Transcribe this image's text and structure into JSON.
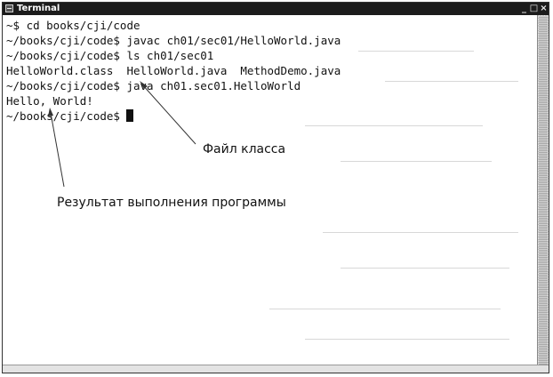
{
  "window": {
    "title": "Terminal",
    "controls": {
      "minimize": "_",
      "maximize": "□",
      "close": "×"
    }
  },
  "terminal": {
    "lines": [
      "~$ cd books/cji/code",
      "~/books/cji/code$ javac ch01/sec01/HelloWorld.java",
      "~/books/cji/code$ ls ch01/sec01",
      "HelloWorld.class  HelloWorld.java  MethodDemo.java",
      "~/books/cji/code$ java ch01.sec01.HelloWorld",
      "Hello, World!"
    ],
    "last_prompt": "~/books/cji/code$ "
  },
  "annotations": {
    "class_file": "Файл класса",
    "program_output": "Результат выполнения программы"
  }
}
